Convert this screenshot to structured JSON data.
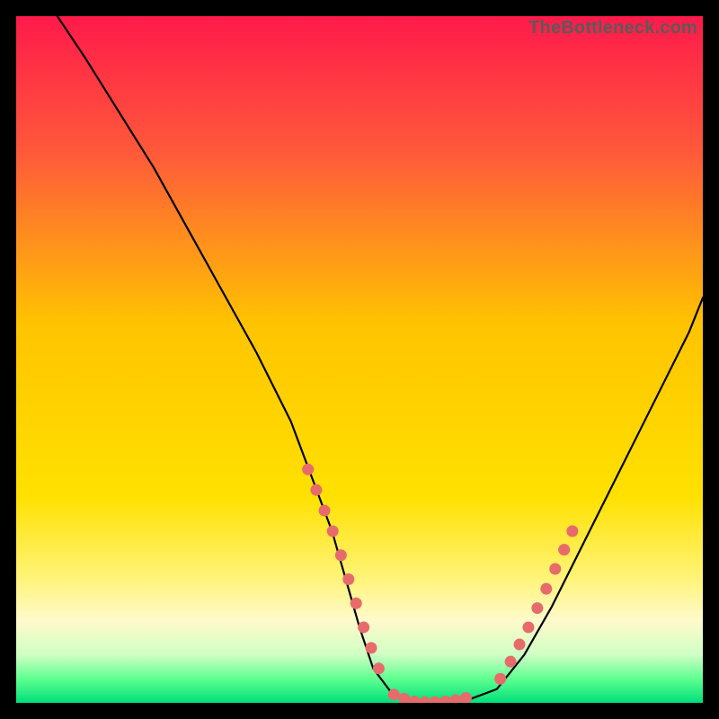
{
  "watermark": "TheBottleneck.com",
  "chart_data": {
    "type": "line",
    "title": "",
    "xlabel": "",
    "ylabel": "",
    "xlim": [
      0,
      100
    ],
    "ylim": [
      0,
      100
    ],
    "grid": false,
    "legend": false,
    "gradient_stops": [
      {
        "offset": 0.0,
        "color": "#ff1a4b"
      },
      {
        "offset": 0.2,
        "color": "#ff5a3a"
      },
      {
        "offset": 0.45,
        "color": "#ffc400"
      },
      {
        "offset": 0.7,
        "color": "#ffe100"
      },
      {
        "offset": 0.82,
        "color": "#fff47a"
      },
      {
        "offset": 0.88,
        "color": "#fffacb"
      },
      {
        "offset": 0.93,
        "color": "#cfffc4"
      },
      {
        "offset": 0.965,
        "color": "#5fff90"
      },
      {
        "offset": 1.0,
        "color": "#00e07a"
      }
    ],
    "series": [
      {
        "name": "bottleneck-curve",
        "stroke": "#000000",
        "stroke_width": 2.2,
        "x": [
          6,
          10,
          15,
          20,
          25,
          30,
          35,
          40,
          43,
          46,
          48,
          50,
          52,
          55,
          58,
          60,
          63,
          66,
          70,
          74,
          78,
          82,
          86,
          90,
          94,
          98,
          100
        ],
        "y": [
          100,
          94,
          86,
          78,
          69,
          60,
          51,
          41,
          33,
          25,
          18,
          11,
          5,
          1,
          0,
          0,
          0,
          0.5,
          2,
          7,
          14,
          22,
          30,
          38,
          46,
          54,
          59
        ]
      }
    ],
    "marker_segments": [
      {
        "name": "left-descent-markers",
        "color": "#e86b6b",
        "radius": 6.5,
        "points": [
          {
            "x": 42.5,
            "y": 34
          },
          {
            "x": 43.7,
            "y": 31
          },
          {
            "x": 44.9,
            "y": 28
          },
          {
            "x": 46.1,
            "y": 25
          },
          {
            "x": 47.3,
            "y": 21.5
          },
          {
            "x": 48.4,
            "y": 18
          },
          {
            "x": 49.5,
            "y": 14.5
          },
          {
            "x": 50.6,
            "y": 11
          },
          {
            "x": 51.7,
            "y": 8
          },
          {
            "x": 52.8,
            "y": 5
          }
        ]
      },
      {
        "name": "valley-floor-markers",
        "color": "#e86b6b",
        "radius": 6.5,
        "points": [
          {
            "x": 55,
            "y": 1.2
          },
          {
            "x": 56.5,
            "y": 0.6
          },
          {
            "x": 58,
            "y": 0.2
          },
          {
            "x": 59.5,
            "y": 0.1
          },
          {
            "x": 61,
            "y": 0.1
          },
          {
            "x": 62.5,
            "y": 0.2
          },
          {
            "x": 64,
            "y": 0.4
          },
          {
            "x": 65.5,
            "y": 0.7
          }
        ]
      },
      {
        "name": "right-ascent-markers",
        "color": "#e86b6b",
        "radius": 6.5,
        "points": [
          {
            "x": 70.5,
            "y": 3.5
          },
          {
            "x": 72,
            "y": 6
          },
          {
            "x": 73.3,
            "y": 8.5
          },
          {
            "x": 74.6,
            "y": 11
          },
          {
            "x": 75.9,
            "y": 13.8
          },
          {
            "x": 77.2,
            "y": 16.6
          },
          {
            "x": 78.5,
            "y": 19.5
          },
          {
            "x": 79.8,
            "y": 22.3
          },
          {
            "x": 81.0,
            "y": 25
          }
        ]
      }
    ]
  }
}
